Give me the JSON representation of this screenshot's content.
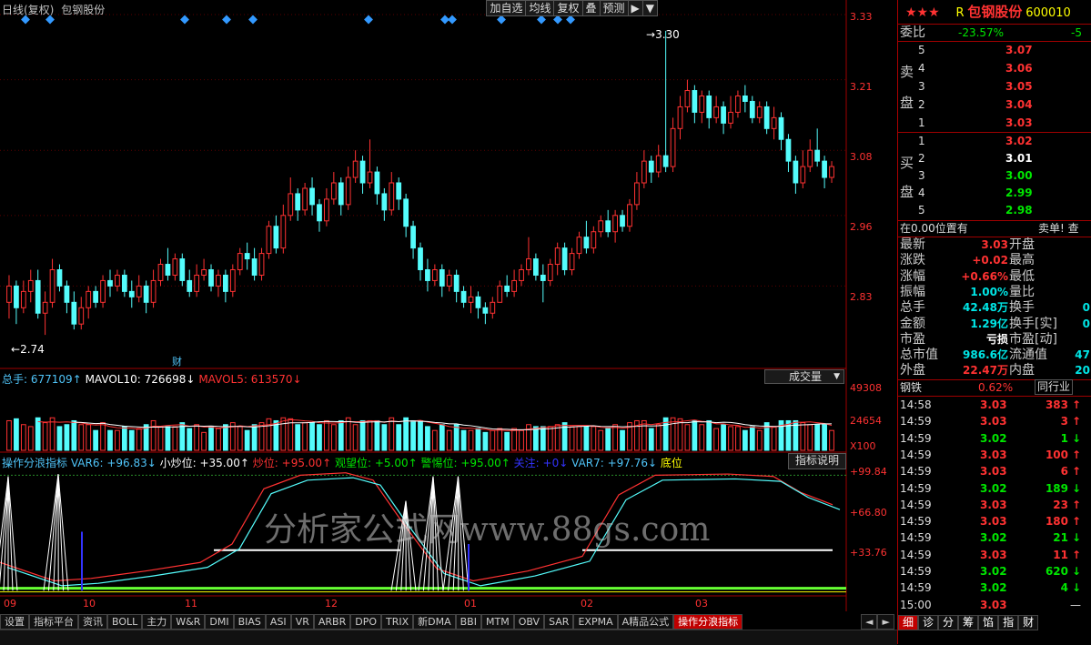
{
  "header": {
    "period": "日线(复权)",
    "stock_name": "包钢股份"
  },
  "toolbar": [
    "加自选",
    "均线",
    "复权",
    "叠",
    "预测",
    "▶",
    "▼"
  ],
  "price_axis": [
    "3.33",
    "3.21",
    "3.08",
    "2.96",
    "2.83"
  ],
  "price_annotations": {
    "high": "3.30",
    "low": "2.74",
    "fin_marker": "财"
  },
  "volume_legend": {
    "total": "总手: 677109",
    "mavol10": "MAVOL10: 726698",
    "mavol5": "MAVOL5: 613570",
    "selector": "成交量"
  },
  "volume_axis": [
    "49308",
    "24654",
    "X100"
  ],
  "indicator_legend": {
    "name": "操作分浪指标",
    "var6": "VAR6: +96.83",
    "small": "小炒位: +35.00",
    "chao": "炒位: +95.00",
    "watch": "观望位: +5.00",
    "alert": "警惕位: +95.00",
    "lock": "关注: +0",
    "var7": "VAR7: +97.76",
    "bottom": "底位",
    "explain": "指标说明"
  },
  "indicator_axis": [
    "+99.84",
    "+66.80",
    "+33.76"
  ],
  "date_axis": [
    "09",
    "10",
    "11",
    "12",
    "01",
    "02",
    "03"
  ],
  "watermark": "分析家公式网www.88gs.com",
  "bottom_tabs": [
    "设置",
    "指标平台",
    "资讯",
    "BOLL",
    "主力",
    "W&R",
    "DMI",
    "BIAS",
    "ASI",
    "VR",
    "ARBR",
    "DPO",
    "TRIX",
    "新DMA",
    "BBI",
    "MTM",
    "OBV",
    "SAR",
    "EXPMA",
    "A精品公式",
    "操作分浪指标"
  ],
  "bottom_nav": [
    "◄",
    "►",
    "细",
    "诊",
    "分",
    "筹",
    "馅",
    "指",
    "财"
  ],
  "quote": {
    "stars": "★★★",
    "r_mark": "R",
    "name": "包钢股份",
    "code": "600010",
    "weibi_label": "委比",
    "weibi_value": "-23.57%",
    "weibi_extra": "-5",
    "sell_label": [
      "卖",
      "盘"
    ],
    "buy_label": [
      "买",
      "盘"
    ],
    "sell": [
      {
        "lvl": "5",
        "price": "3.07"
      },
      {
        "lvl": "4",
        "price": "3.06"
      },
      {
        "lvl": "3",
        "price": "3.05"
      },
      {
        "lvl": "2",
        "price": "3.04"
      },
      {
        "lvl": "1",
        "price": "3.03"
      }
    ],
    "buy": [
      {
        "lvl": "1",
        "price": "3.02"
      },
      {
        "lvl": "2",
        "price": "3.01"
      },
      {
        "lvl": "3",
        "price": "3.00"
      },
      {
        "lvl": "4",
        "price": "2.99"
      },
      {
        "lvl": "5",
        "price": "2.98"
      }
    ],
    "status_left": "在0.00位置有",
    "status_right": "卖单! 查",
    "stats": [
      {
        "l": "最新",
        "v": "3.03",
        "c": "red",
        "r": "开盘"
      },
      {
        "l": "涨跌",
        "v": "+0.02",
        "c": "red",
        "r": "最高"
      },
      {
        "l": "涨幅",
        "v": "+0.66%",
        "c": "red",
        "r": "最低"
      },
      {
        "l": "振幅",
        "v": "1.00%",
        "c": "cyan",
        "r": "量比"
      },
      {
        "l": "总手",
        "v": "42.48万",
        "c": "cyan",
        "r": "换手"
      },
      {
        "l": "金额",
        "v": "1.29亿",
        "c": "cyan",
        "r": "换手[实]"
      },
      {
        "l": "市盈",
        "v": "亏损",
        "c": "white",
        "r": "市盈[动]"
      },
      {
        "l": "总市值",
        "v": "986.6亿",
        "c": "cyan",
        "r": "流通值"
      },
      {
        "l": "外盘",
        "v": "22.47万",
        "c": "red",
        "r": "内盘"
      }
    ],
    "stats_right_nums": [
      "",
      "",
      "",
      "",
      "0",
      "0",
      "",
      "47",
      "20"
    ],
    "sector": {
      "name": "钢铁",
      "pct": "0.62%",
      "tab": "同行业"
    },
    "ticks": [
      {
        "t": "14:58",
        "p": "3.03",
        "pc": "red",
        "v": "383",
        "d": "up"
      },
      {
        "t": "14:59",
        "p": "3.03",
        "pc": "red",
        "v": "3",
        "d": "up"
      },
      {
        "t": "14:59",
        "p": "3.02",
        "pc": "green",
        "v": "1",
        "d": "down"
      },
      {
        "t": "14:59",
        "p": "3.03",
        "pc": "red",
        "v": "100",
        "d": "up"
      },
      {
        "t": "14:59",
        "p": "3.03",
        "pc": "red",
        "v": "6",
        "d": "up"
      },
      {
        "t": "14:59",
        "p": "3.02",
        "pc": "green",
        "v": "189",
        "d": "down"
      },
      {
        "t": "14:59",
        "p": "3.03",
        "pc": "red",
        "v": "23",
        "d": "up"
      },
      {
        "t": "14:59",
        "p": "3.03",
        "pc": "red",
        "v": "180",
        "d": "up"
      },
      {
        "t": "14:59",
        "p": "3.02",
        "pc": "green",
        "v": "21",
        "d": "down"
      },
      {
        "t": "14:59",
        "p": "3.03",
        "pc": "red",
        "v": "11",
        "d": "up"
      },
      {
        "t": "14:59",
        "p": "3.02",
        "pc": "green",
        "v": "620",
        "d": "down"
      },
      {
        "t": "14:59",
        "p": "3.02",
        "pc": "green",
        "v": "4",
        "d": "down"
      },
      {
        "t": "15:00",
        "p": "3.03",
        "pc": "red",
        "v": "",
        "d": ""
      }
    ]
  },
  "chart_data": {
    "type": "candlestick",
    "ylim": [
      2.7,
      3.34
    ],
    "candles": [
      [
        2.8,
        2.83,
        2.85,
        2.77
      ],
      [
        2.83,
        2.79,
        2.84,
        2.76
      ],
      [
        2.79,
        2.82,
        2.84,
        2.78
      ],
      [
        2.82,
        2.84,
        2.86,
        2.8
      ],
      [
        2.84,
        2.78,
        2.86,
        2.77
      ],
      [
        2.78,
        2.8,
        2.82,
        2.74
      ],
      [
        2.8,
        2.86,
        2.88,
        2.79
      ],
      [
        2.86,
        2.83,
        2.87,
        2.82
      ],
      [
        2.83,
        2.8,
        2.84,
        2.78
      ],
      [
        2.8,
        2.76,
        2.82,
        2.75
      ],
      [
        2.76,
        2.79,
        2.81,
        2.75
      ],
      [
        2.79,
        2.82,
        2.83,
        2.77
      ],
      [
        2.82,
        2.8,
        2.83,
        2.79
      ],
      [
        2.8,
        2.84,
        2.85,
        2.79
      ],
      [
        2.84,
        2.83,
        2.86,
        2.81
      ],
      [
        2.83,
        2.85,
        2.86,
        2.82
      ],
      [
        2.85,
        2.82,
        2.86,
        2.81
      ],
      [
        2.82,
        2.81,
        2.84,
        2.79
      ],
      [
        2.81,
        2.83,
        2.85,
        2.8
      ],
      [
        2.83,
        2.8,
        2.84,
        2.78
      ],
      [
        2.8,
        2.84,
        2.86,
        2.79
      ],
      [
        2.84,
        2.87,
        2.88,
        2.83
      ],
      [
        2.87,
        2.85,
        2.9,
        2.84
      ],
      [
        2.85,
        2.88,
        2.89,
        2.84
      ],
      [
        2.88,
        2.84,
        2.89,
        2.83
      ],
      [
        2.84,
        2.82,
        2.86,
        2.81
      ],
      [
        2.82,
        2.85,
        2.87,
        2.81
      ],
      [
        2.85,
        2.86,
        2.88,
        2.84
      ],
      [
        2.86,
        2.83,
        2.87,
        2.82
      ],
      [
        2.83,
        2.85,
        2.86,
        2.81
      ],
      [
        2.85,
        2.82,
        2.86,
        2.8
      ],
      [
        2.82,
        2.86,
        2.87,
        2.81
      ],
      [
        2.86,
        2.89,
        2.9,
        2.85
      ],
      [
        2.89,
        2.88,
        2.91,
        2.86
      ],
      [
        2.88,
        2.85,
        2.9,
        2.84
      ],
      [
        2.85,
        2.89,
        2.9,
        2.84
      ],
      [
        2.89,
        2.94,
        2.95,
        2.88
      ],
      [
        2.94,
        2.9,
        2.96,
        2.89
      ],
      [
        2.9,
        2.96,
        2.98,
        2.89
      ],
      [
        2.96,
        3.0,
        3.03,
        2.95
      ],
      [
        3.0,
        2.97,
        3.01,
        2.95
      ],
      [
        2.97,
        3.01,
        3.02,
        2.96
      ],
      [
        3.01,
        2.98,
        3.03,
        2.96
      ],
      [
        2.98,
        2.95,
        2.99,
        2.93
      ],
      [
        2.95,
        2.99,
        3.01,
        2.94
      ],
      [
        2.99,
        3.02,
        3.04,
        2.98
      ],
      [
        3.02,
        2.98,
        3.03,
        2.96
      ],
      [
        2.98,
        3.03,
        3.05,
        2.97
      ],
      [
        3.03,
        3.06,
        3.08,
        3.02
      ],
      [
        3.06,
        3.02,
        3.07,
        3.0
      ],
      [
        3.02,
        3.04,
        3.1,
        3.01
      ],
      [
        3.04,
        3.0,
        3.05,
        2.98
      ],
      [
        3.0,
        2.97,
        3.01,
        2.95
      ],
      [
        2.97,
        3.02,
        3.04,
        2.96
      ],
      [
        3.02,
        2.99,
        3.03,
        2.97
      ],
      [
        2.99,
        2.94,
        3.0,
        2.92
      ],
      [
        2.94,
        2.9,
        2.95,
        2.88
      ],
      [
        2.9,
        2.86,
        2.91,
        2.84
      ],
      [
        2.86,
        2.84,
        2.88,
        2.82
      ],
      [
        2.84,
        2.86,
        2.87,
        2.83
      ],
      [
        2.86,
        2.83,
        2.87,
        2.81
      ],
      [
        2.83,
        2.85,
        2.86,
        2.82
      ],
      [
        2.85,
        2.82,
        2.86,
        2.8
      ],
      [
        2.82,
        2.8,
        2.83,
        2.79
      ],
      [
        2.8,
        2.81,
        2.83,
        2.78
      ],
      [
        2.81,
        2.79,
        2.82,
        2.77
      ],
      [
        2.79,
        2.78,
        2.8,
        2.76
      ],
      [
        2.78,
        2.8,
        2.81,
        2.77
      ],
      [
        2.8,
        2.83,
        2.84,
        2.8
      ],
      [
        2.83,
        2.82,
        2.85,
        2.81
      ],
      [
        2.82,
        2.84,
        2.86,
        2.81
      ],
      [
        2.84,
        2.86,
        2.87,
        2.83
      ],
      [
        2.86,
        2.88,
        2.92,
        2.85
      ],
      [
        2.88,
        2.85,
        2.89,
        2.84
      ],
      [
        2.85,
        2.84,
        2.87,
        2.8
      ],
      [
        2.84,
        2.87,
        2.88,
        2.83
      ],
      [
        2.87,
        2.9,
        2.91,
        2.85
      ],
      [
        2.9,
        2.86,
        2.91,
        2.85
      ],
      [
        2.86,
        2.89,
        2.9,
        2.85
      ],
      [
        2.89,
        2.92,
        2.93,
        2.88
      ],
      [
        2.92,
        2.9,
        2.95,
        2.89
      ],
      [
        2.9,
        2.93,
        2.94,
        2.89
      ],
      [
        2.93,
        2.95,
        2.96,
        2.92
      ],
      [
        2.95,
        2.93,
        2.97,
        2.92
      ],
      [
        2.93,
        2.96,
        2.97,
        2.91
      ],
      [
        2.96,
        2.94,
        2.97,
        2.93
      ],
      [
        2.94,
        2.98,
        2.99,
        2.93
      ],
      [
        2.98,
        3.02,
        3.04,
        2.97
      ],
      [
        3.02,
        3.06,
        3.08,
        3.01
      ],
      [
        3.06,
        3.04,
        3.07,
        3.02
      ],
      [
        3.04,
        3.07,
        3.09,
        3.03
      ],
      [
        3.07,
        3.05,
        3.3,
        3.04
      ],
      [
        3.05,
        3.12,
        3.14,
        3.04
      ],
      [
        3.12,
        3.16,
        3.18,
        3.1
      ],
      [
        3.16,
        3.19,
        3.21,
        3.15
      ],
      [
        3.19,
        3.15,
        3.2,
        3.13
      ],
      [
        3.15,
        3.18,
        3.19,
        3.13
      ],
      [
        3.18,
        3.14,
        3.19,
        3.12
      ],
      [
        3.14,
        3.16,
        3.18,
        3.13
      ],
      [
        3.16,
        3.13,
        3.17,
        3.11
      ],
      [
        3.13,
        3.15,
        3.18,
        3.12
      ],
      [
        3.15,
        3.18,
        3.19,
        3.14
      ],
      [
        3.18,
        3.17,
        3.2,
        3.15
      ],
      [
        3.17,
        3.14,
        3.18,
        3.13
      ],
      [
        3.14,
        3.16,
        3.17,
        3.13
      ],
      [
        3.16,
        3.12,
        3.17,
        3.11
      ],
      [
        3.12,
        3.14,
        3.16,
        3.1
      ],
      [
        3.14,
        3.1,
        3.15,
        3.08
      ],
      [
        3.1,
        3.06,
        3.11,
        3.04
      ],
      [
        3.06,
        3.02,
        3.07,
        3.0
      ],
      [
        3.02,
        3.05,
        3.08,
        3.01
      ],
      [
        3.05,
        3.08,
        3.1,
        3.04
      ],
      [
        3.08,
        3.06,
        3.12,
        3.05
      ],
      [
        3.06,
        3.03,
        3.07,
        3.01
      ],
      [
        3.03,
        3.05,
        3.06,
        3.02
      ]
    ]
  }
}
